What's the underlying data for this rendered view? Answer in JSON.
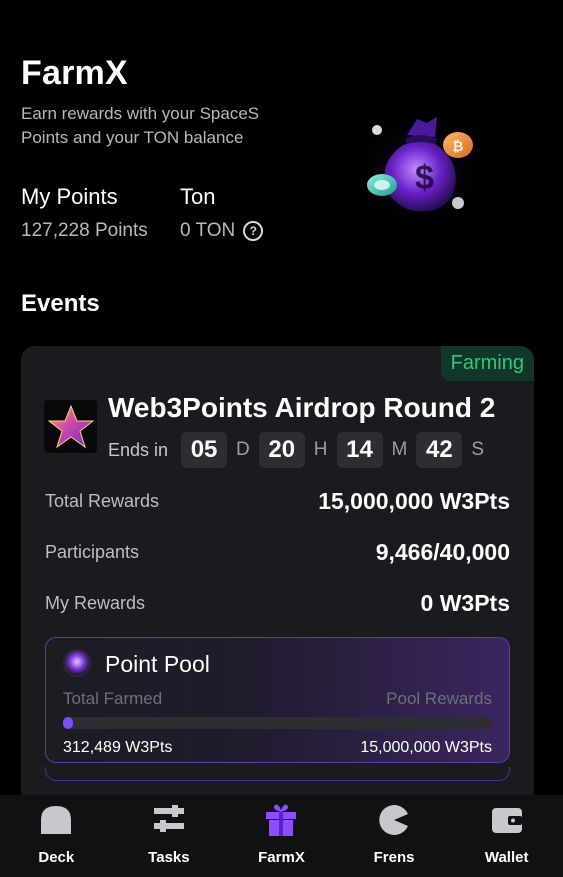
{
  "header": {
    "title": "FarmX",
    "subtitle": "Earn rewards with your SpaceS Points and your TON balance"
  },
  "stats": {
    "points_label": "My Points",
    "points_value": "127,228 Points",
    "ton_label": "Ton",
    "ton_value": "0 TON",
    "help_icon": "question-circle-icon"
  },
  "events": {
    "title": "Events"
  },
  "event": {
    "status": "Farming",
    "name": "Web3Points Airdrop Round 2",
    "ends_label": "Ends in",
    "countdown": [
      {
        "value": "05",
        "unit": "D"
      },
      {
        "value": "20",
        "unit": "H"
      },
      {
        "value": "14",
        "unit": "M"
      },
      {
        "value": "42",
        "unit": "S"
      }
    ],
    "rows": [
      {
        "label": "Total Rewards",
        "value": "15,000,000 W3Pts"
      },
      {
        "label": "Participants",
        "value": "9,466/40,000"
      },
      {
        "label": "My Rewards",
        "value": "0 W3Pts"
      }
    ],
    "pool": {
      "title": "Point Pool",
      "left_label": "Total Farmed",
      "right_label": "Pool Rewards",
      "left_value": "312,489 W3Pts",
      "right_value": "15,000,000 W3Pts",
      "progress_fraction": 0.0208
    }
  },
  "nav": {
    "items": [
      {
        "label": "Deck",
        "icon": "deck-icon"
      },
      {
        "label": "Tasks",
        "icon": "tasks-icon"
      },
      {
        "label": "FarmX",
        "icon": "gift-icon",
        "active": true
      },
      {
        "label": "Frens",
        "icon": "frens-icon"
      },
      {
        "label": "Wallet",
        "icon": "wallet-icon"
      }
    ]
  },
  "colors": {
    "accent": "#7c4dff",
    "status_green": "#33c77a",
    "card_bg": "#1a1a1f"
  }
}
